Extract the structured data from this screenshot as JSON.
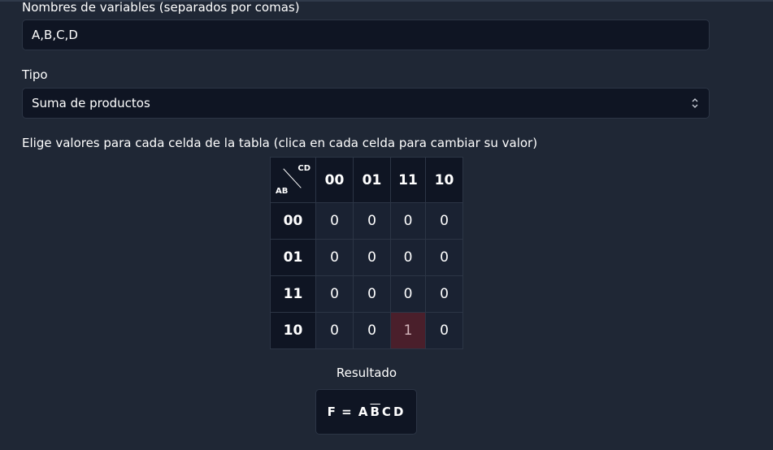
{
  "form": {
    "variables_label": "Nombres de variables (separados por comas)",
    "variables_value": "A,B,C,D",
    "type_label": "Tipo",
    "type_value": "Suma de productos",
    "table_instruction": "Elige valores para cada celda de la tabla (clica en cada celda para cambiar su valor)"
  },
  "kmap": {
    "corner_col_label": "CD",
    "corner_row_label": "AB",
    "col_headers": [
      "00",
      "01",
      "11",
      "10"
    ],
    "row_headers": [
      "00",
      "01",
      "11",
      "10"
    ],
    "cells": [
      [
        "0",
        "0",
        "0",
        "0"
      ],
      [
        "0",
        "0",
        "0",
        "0"
      ],
      [
        "0",
        "0",
        "0",
        "0"
      ],
      [
        "0",
        "0",
        "1",
        "0"
      ]
    ],
    "highlight_color": "#4a1f2b"
  },
  "result": {
    "title": "Resultado",
    "prefix": "F =",
    "terms": [
      "A",
      "B",
      "C",
      "D"
    ],
    "negated": [
      false,
      true,
      false,
      false
    ]
  }
}
